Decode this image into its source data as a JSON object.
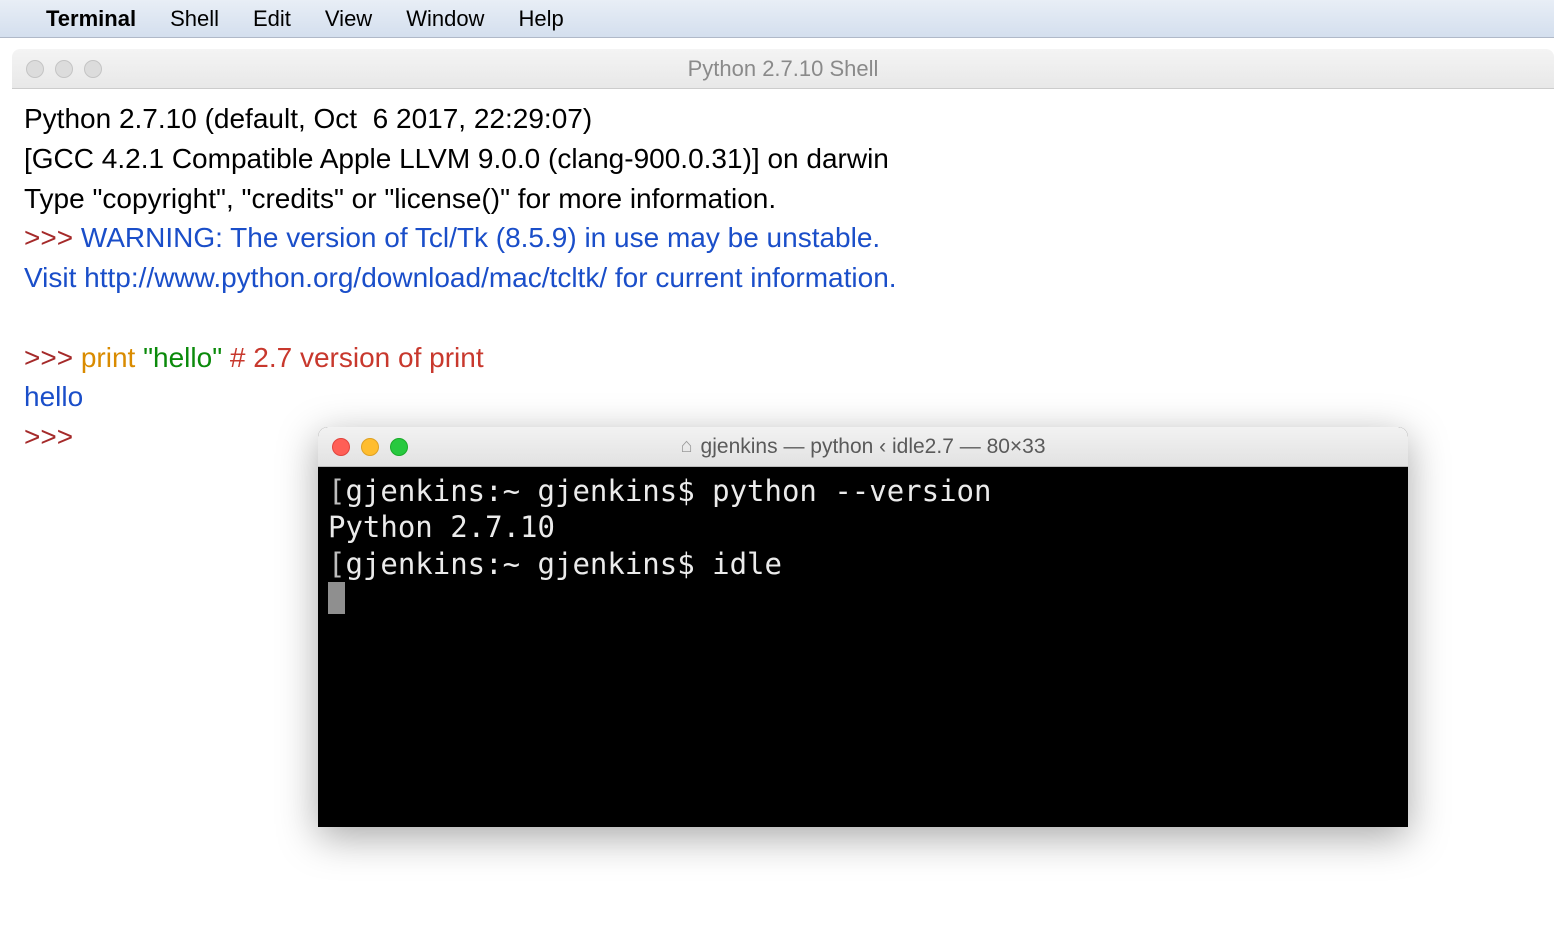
{
  "menubar": {
    "app_name": "Terminal",
    "items": [
      "Shell",
      "Edit",
      "View",
      "Window",
      "Help"
    ]
  },
  "idle": {
    "title": "Python 2.7.10 Shell",
    "line1": "Python 2.7.10 (default, Oct  6 2017, 22:29:07) ",
    "line2": "[GCC 4.2.1 Compatible Apple LLVM 9.0.0 (clang-900.0.31)] on darwin",
    "line3": "Type \"copyright\", \"credits\" or \"license()\" for more information.",
    "prompt": ">>> ",
    "warning": "WARNING: The version of Tcl/Tk (8.5.9) in use may be unstable.",
    "visit_prefix": "Visit ",
    "visit_url": "http://www.python.org/download/mac/tcltk/",
    "visit_suffix": " for current information.",
    "print_kw": "print",
    "print_str": "\"hello\"",
    "print_comment": "# 2.7 version of print",
    "output": "hello"
  },
  "terminal": {
    "title_user": "gjenkins",
    "title_sep1": " — ",
    "title_proc": "python ‹ idle2.7",
    "title_sep2": " — ",
    "title_size": "80×33",
    "line1_prompt": "gjenkins:~ gjenkins$ ",
    "line1_cmd": "python --version",
    "line2": "Python 2.7.10",
    "line3_prompt": "gjenkins:~ gjenkins$ ",
    "line3_cmd": "idle"
  }
}
